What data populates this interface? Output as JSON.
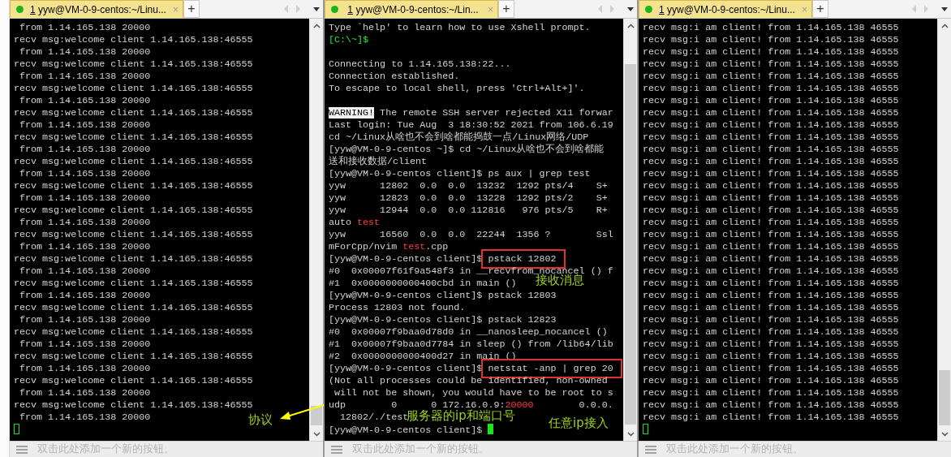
{
  "panes": [
    {
      "tab": {
        "number": "1",
        "title": "yyw@VM-0-9-centos:~/Linu...",
        "close": "×",
        "selected": true
      },
      "new_tab": "+",
      "bar_hint": "双击此处添加一个新的按钮。",
      "cursor": {
        "focused": false
      },
      "lines": [
        " from 1.14.165.138 20000",
        "recv msg:welcome client 1.14.165.138:46555",
        " from 1.14.165.138 20000",
        "recv msg:welcome client 1.14.165.138:46555",
        " from 1.14.165.138 20000",
        "recv msg:welcome client 1.14.165.138:46555",
        " from 1.14.165.138 20000",
        "recv msg:welcome client 1.14.165.138:46555",
        " from 1.14.165.138 20000",
        "recv msg:welcome client 1.14.165.138:46555",
        " from 1.14.165.138 20000",
        "recv msg:welcome client 1.14.165.138:46555",
        " from 1.14.165.138 20000",
        "recv msg:welcome client 1.14.165.138:46555",
        " from 1.14.165.138 20000",
        "recv msg:welcome client 1.14.165.138:46555",
        " from 1.14.165.138 20000",
        "recv msg:welcome client 1.14.165.138:46555",
        " from 1.14.165.138 20000",
        "recv msg:welcome client 1.14.165.138:46555",
        " from 1.14.165.138 20000",
        "recv msg:welcome client 1.14.165.138:46555",
        " from 1.14.165.138 20000",
        "recv msg:welcome client 1.14.165.138:46555",
        " from 1.14.165.138 20000",
        "recv msg:welcome client 1.14.165.138:46555",
        " from 1.14.165.138 20000",
        "recv msg:welcome client 1.14.165.138:46555",
        " from 1.14.165.138 20000",
        "recv msg:welcome client 1.14.165.138:46555",
        " from 1.14.165.138 20000",
        "recv msg:welcome client 1.14.165.138:46555",
        " from 1.14.165.138 20000"
      ]
    },
    {
      "tab": {
        "number": "1",
        "title": "yyw@VM-0-9-centos:~/Lin...",
        "close": "×",
        "selected": true
      },
      "new_tab": "+",
      "bar_hint": "双击此处添加一个新的按钮。",
      "cursor": {
        "focused": true
      },
      "lines": [
        {
          "segments": [
            {
              "kind": "text",
              "text": "Type `help' to learn how to use Xshell prompt."
            }
          ]
        },
        {
          "segments": [
            {
              "kind": "prompt",
              "text": "[C:\\~]$"
            }
          ]
        },
        {
          "kind": "blank"
        },
        {
          "segments": [
            {
              "kind": "text",
              "text": "Connecting to 1.14.165.138:22..."
            }
          ]
        },
        {
          "segments": [
            {
              "kind": "text",
              "text": "Connection established."
            }
          ]
        },
        {
          "segments": [
            {
              "kind": "text",
              "text": "To escape to local shell, press 'Ctrl+Alt+]'."
            }
          ]
        },
        {
          "kind": "blank"
        },
        {
          "segments": [
            {
              "kind": "warning",
              "text": "WARNING!"
            },
            {
              "kind": "text",
              "text": " The remote SSH server rejected X11 forwar"
            }
          ]
        },
        {
          "segments": [
            {
              "kind": "text",
              "text": "Last login: Tue Aug  3 18:30:52 2021 from 106.6.19"
            }
          ]
        },
        {
          "segments": [
            {
              "kind": "text",
              "text": "cd ~/Linux从啥也不会到啥都能捣鼓一点/Linux网络/UDP"
            }
          ]
        },
        {
          "segments": [
            {
              "kind": "text",
              "text": "[yyw@VM-0-9-centos ~]$ cd ~/Linux从啥也不会到啥都能"
            }
          ]
        },
        {
          "segments": [
            {
              "kind": "text",
              "text": "送和接收数据/client"
            }
          ]
        },
        {
          "segments": [
            {
              "kind": "text",
              "text": "[yyw@VM-0-9-centos client]$ ps aux | grep test"
            }
          ]
        },
        {
          "segments": [
            {
              "kind": "text",
              "text": "yyw      12802  0.0  0.0  13232  1292 pts/4    S+"
            }
          ]
        },
        {
          "segments": [
            {
              "kind": "text",
              "text": "yyw      12823  0.0  0.0  13228  1292 pts/2    S+"
            }
          ]
        },
        {
          "segments": [
            {
              "kind": "text",
              "text": "yyw      12944  0.0  0.0 112816   976 pts/5    R+"
            }
          ]
        },
        {
          "segments": [
            {
              "kind": "text",
              "text": "auto "
            },
            {
              "kind": "match",
              "text": "test"
            }
          ]
        },
        {
          "segments": [
            {
              "kind": "text",
              "text": "yyw      16560  0.0  0.0  22244  1356 ?        Ssl"
            }
          ]
        },
        {
          "segments": [
            {
              "kind": "text",
              "text": "mForCpp/nvim "
            },
            {
              "kind": "match",
              "text": "test"
            },
            {
              "kind": "text",
              "text": ".cpp"
            }
          ]
        },
        {
          "segments": [
            {
              "kind": "text",
              "text": "[yyw@VM-0-9-centos client]$ "
            },
            {
              "kind": "boxed",
              "text": "pstack 12802"
            }
          ]
        },
        {
          "segments": [
            {
              "kind": "text",
              "text": "#0  0x00007f61f9a548f3 in __recvfrom_nocancel () f"
            }
          ]
        },
        {
          "segments": [
            {
              "kind": "text",
              "text": "#1  0x0000000000400cbd in main ()"
            }
          ]
        },
        {
          "segments": [
            {
              "kind": "text",
              "text": "[yyw@VM-0-9-centos client]$ pstack 12803"
            }
          ]
        },
        {
          "segments": [
            {
              "kind": "text",
              "text": "Process 12803 not found."
            }
          ]
        },
        {
          "segments": [
            {
              "kind": "text",
              "text": "[yyw@VM-0-9-centos client]$ pstack 12823"
            }
          ]
        },
        {
          "segments": [
            {
              "kind": "text",
              "text": "#0  0x00007f9baa0d78d0 in __nanosleep_nocancel ()"
            }
          ]
        },
        {
          "segments": [
            {
              "kind": "text",
              "text": "#1  0x00007f9baa0d7784 in sleep () from /lib64/lib"
            }
          ]
        },
        {
          "segments": [
            {
              "kind": "text",
              "text": "#2  0x0000000000400d27 in main ()"
            }
          ]
        },
        {
          "segments": [
            {
              "kind": "text",
              "text": "[yyw@VM-0-9-centos client]$ "
            },
            {
              "kind": "boxed",
              "text": "netstat -anp | grep 20"
            }
          ]
        },
        {
          "segments": [
            {
              "kind": "text",
              "text": "(Not all processes could be identified, non-owned"
            }
          ]
        },
        {
          "segments": [
            {
              "kind": "text",
              "text": " will not be shown, you would have to be root to s"
            }
          ]
        },
        {
          "segments": [
            {
              "kind": "text",
              "text": "udp        0      0 172.16.0.9:"
            },
            {
              "kind": "match",
              "text": "20000"
            },
            {
              "kind": "text",
              "text": "        0.0.0."
            }
          ]
        },
        {
          "segments": [
            {
              "kind": "text",
              "text": "  12802/./test"
            }
          ]
        },
        {
          "segments": [
            {
              "kind": "text",
              "text": "[yyw@VM-0-9-centos client]$ "
            }
          ]
        }
      ]
    },
    {
      "tab": {
        "number": "1",
        "title": "yyw@VM-0-9-centos:~/Linu...",
        "close": "×",
        "selected": true
      },
      "new_tab": "+",
      "bar_hint": "双击此处添加一个新的按钮。",
      "cursor": {
        "focused": false
      },
      "lines": [
        "recv msg:i am client! from 1.14.165.138 46555",
        "recv msg:i am client! from 1.14.165.138 46555",
        "recv msg:i am client! from 1.14.165.138 46555",
        "recv msg:i am client! from 1.14.165.138 46555",
        "recv msg:i am client! from 1.14.165.138 46555",
        "recv msg:i am client! from 1.14.165.138 46555",
        "recv msg:i am client! from 1.14.165.138 46555",
        "recv msg:i am client! from 1.14.165.138 46555",
        "recv msg:i am client! from 1.14.165.138 46555",
        "recv msg:i am client! from 1.14.165.138 46555",
        "recv msg:i am client! from 1.14.165.138 46555",
        "recv msg:i am client! from 1.14.165.138 46555",
        "recv msg:i am client! from 1.14.165.138 46555",
        "recv msg:i am client! from 1.14.165.138 46555",
        "recv msg:i am client! from 1.14.165.138 46555",
        "recv msg:i am client! from 1.14.165.138 46555",
        "recv msg:i am client! from 1.14.165.138 46555",
        "recv msg:i am client! from 1.14.165.138 46555",
        "recv msg:i am client! from 1.14.165.138 46555",
        "recv msg:i am client! from 1.14.165.138 46555",
        "recv msg:i am client! from 1.14.165.138 46555",
        "recv msg:i am client! from 1.14.165.138 46555",
        "recv msg:i am client! from 1.14.165.138 46555",
        "recv msg:i am client! from 1.14.165.138 46555",
        "recv msg:i am client! from 1.14.165.138 46555",
        "recv msg:i am client! from 1.14.165.138 46555",
        "recv msg:i am client! from 1.14.165.138 46555",
        "recv msg:i am client! from 1.14.165.138 46555",
        "recv msg:i am client! from 1.14.165.138 46555",
        "recv msg:i am client! from 1.14.165.138 46555",
        "recv msg:i am client! from 1.14.165.138 46555",
        "recv msg:i am client! from 1.14.165.138 46555",
        "recv msg:i am client! from 1.14.165.138 46555"
      ]
    }
  ],
  "annotations": [
    {
      "text": "接收消息"
    },
    {
      "text": "协议"
    },
    {
      "text": "服务器的ip和端口号"
    },
    {
      "text": "任意ip接入"
    }
  ]
}
